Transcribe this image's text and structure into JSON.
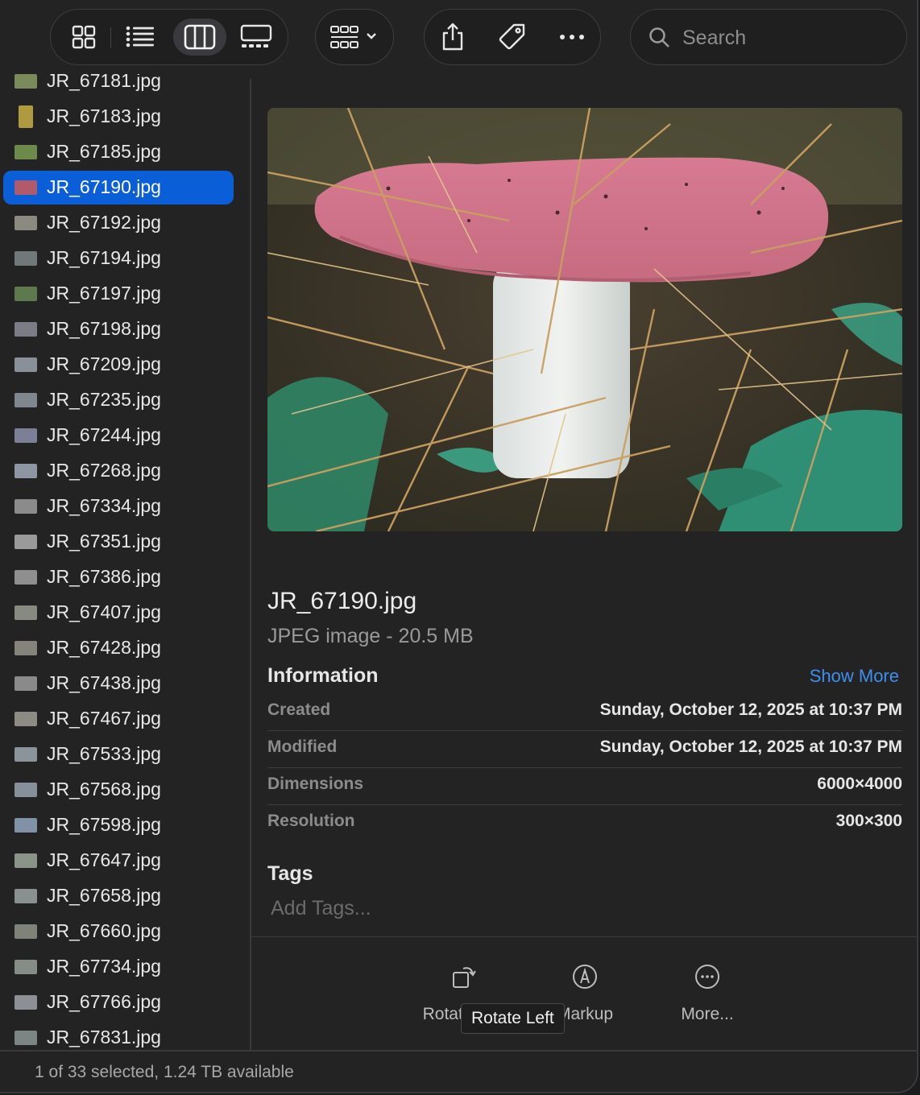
{
  "toolbar": {
    "view_buttons": [
      {
        "icon": "icon-view-icon",
        "active": false
      },
      {
        "icon": "list-view-icon",
        "active": false
      },
      {
        "icon": "column-view-icon",
        "active": true
      },
      {
        "icon": "gallery-view-icon",
        "active": false
      }
    ],
    "group_icon": "group-by-icon",
    "action_icons": [
      "share-icon",
      "tag-icon",
      "more-icon"
    ],
    "search": {
      "placeholder": "Search",
      "value": "",
      "icon": "search-icon"
    }
  },
  "files": [
    {
      "name": "JR_67181.jpg",
      "thumb": "#7a8a58",
      "selected": false
    },
    {
      "name": "JR_67183.jpg",
      "thumb": "#b09a40",
      "selected": false,
      "portrait": true
    },
    {
      "name": "JR_67185.jpg",
      "thumb": "#6e8a4a",
      "selected": false
    },
    {
      "name": "JR_67190.jpg",
      "thumb": "#b05a6a",
      "selected": true
    },
    {
      "name": "JR_67192.jpg",
      "thumb": "#8a8a80",
      "selected": false
    },
    {
      "name": "JR_67194.jpg",
      "thumb": "#707878",
      "selected": false
    },
    {
      "name": "JR_67197.jpg",
      "thumb": "#5d7a4e",
      "selected": false
    },
    {
      "name": "JR_67198.jpg",
      "thumb": "#7c7c86",
      "selected": false
    },
    {
      "name": "JR_67209.jpg",
      "thumb": "#8a909a",
      "selected": false
    },
    {
      "name": "JR_67235.jpg",
      "thumb": "#80868e",
      "selected": false
    },
    {
      "name": "JR_67244.jpg",
      "thumb": "#7d7f96",
      "selected": false
    },
    {
      "name": "JR_67268.jpg",
      "thumb": "#8e96a4",
      "selected": false
    },
    {
      "name": "JR_67334.jpg",
      "thumb": "#8b8b8b",
      "selected": false
    },
    {
      "name": "JR_67351.jpg",
      "thumb": "#9a9a9a",
      "selected": false
    },
    {
      "name": "JR_67386.jpg",
      "thumb": "#8f8f8f",
      "selected": false
    },
    {
      "name": "JR_67407.jpg",
      "thumb": "#868a80",
      "selected": false
    },
    {
      "name": "JR_67428.jpg",
      "thumb": "#84847c",
      "selected": false
    },
    {
      "name": "JR_67438.jpg",
      "thumb": "#8a8a8a",
      "selected": false
    },
    {
      "name": "JR_67467.jpg",
      "thumb": "#8c8c84",
      "selected": false
    },
    {
      "name": "JR_67533.jpg",
      "thumb": "#8a949a",
      "selected": false
    },
    {
      "name": "JR_67568.jpg",
      "thumb": "#86909a",
      "selected": false
    },
    {
      "name": "JR_67598.jpg",
      "thumb": "#8292a6",
      "selected": false
    },
    {
      "name": "JR_67647.jpg",
      "thumb": "#8a9488",
      "selected": false
    },
    {
      "name": "JR_67658.jpg",
      "thumb": "#8a9090",
      "selected": false
    },
    {
      "name": "JR_67660.jpg",
      "thumb": "#7e8278",
      "selected": false
    },
    {
      "name": "JR_67734.jpg",
      "thumb": "#868c86",
      "selected": false
    },
    {
      "name": "JR_67766.jpg",
      "thumb": "#8c9094",
      "selected": false
    },
    {
      "name": "JR_67831.jpg",
      "thumb": "#7d8484",
      "selected": false
    }
  ],
  "preview": {
    "title": "JR_67190.jpg",
    "subtitle": "JPEG image - 20.5 MB",
    "information_label": "Information",
    "show_more": "Show More",
    "info": [
      {
        "key": "Created",
        "value": "Sunday, October 12, 2025 at 10:37 PM"
      },
      {
        "key": "Modified",
        "value": "Sunday, October 12, 2025 at 10:37 PM"
      },
      {
        "key": "Dimensions",
        "value": "6000×4000"
      },
      {
        "key": "Resolution",
        "value": "300×300"
      }
    ],
    "tags_label": "Tags",
    "add_tags_placeholder": "Add Tags..."
  },
  "actions": [
    {
      "label": "Rotate Left",
      "icon": "rotate-left-icon"
    },
    {
      "label": "Markup",
      "icon": "markup-icon"
    },
    {
      "label": "More...",
      "icon": "more-circle-icon"
    }
  ],
  "tooltip": "Rotate Left",
  "status": "1 of 33 selected, 1.24 TB available",
  "colors": {
    "selection": "#0a5ed7",
    "link": "#3d8fef",
    "background": "#232323"
  }
}
